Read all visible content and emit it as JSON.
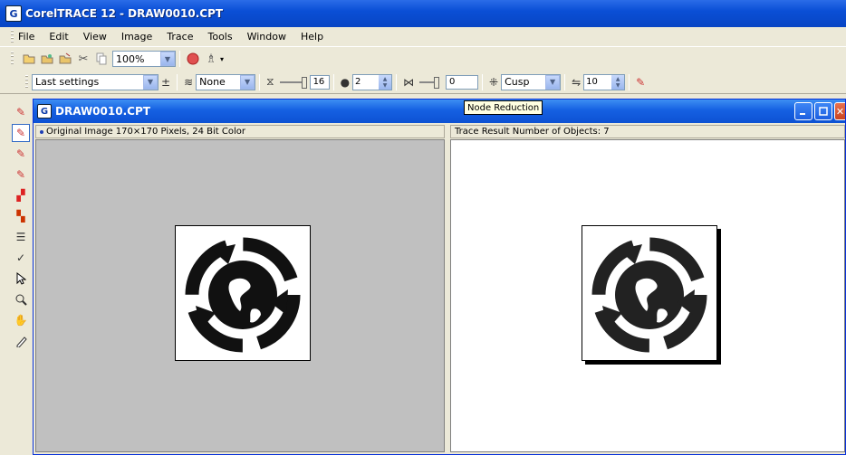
{
  "app": {
    "title": "CorelTRACE 12 - DRAW0010.CPT",
    "icon_letter": "G"
  },
  "menu": [
    "File",
    "Edit",
    "View",
    "Image",
    "Trace",
    "Tools",
    "Window",
    "Help"
  ],
  "toolbar1": {
    "zoom": "100%"
  },
  "toolbar2": {
    "preset": "Last settings",
    "smoothing": "None",
    "detail_value": "16",
    "noise_value": "2",
    "node_reduction_value": "0",
    "node_type": "Cusp",
    "corner_value": "10"
  },
  "document": {
    "title": "DRAW0010.CPT",
    "tooltip": "Node Reduction",
    "left_header": "Original Image   170×170 Pixels, 24 Bit Color",
    "right_header": "Trace Result   Number of Objects: 7"
  },
  "icons": {
    "colors": {
      "title_bar": "#0a4fd6",
      "close": "#c94320",
      "pane_gray": "#c0c0c0"
    }
  }
}
